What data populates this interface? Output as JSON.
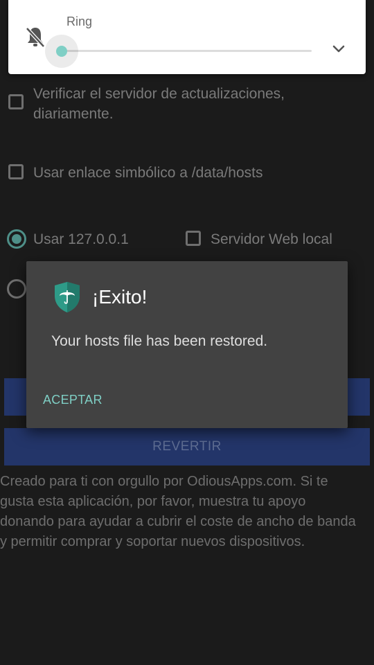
{
  "volume_panel": {
    "stream_label": "Ring",
    "level": 0,
    "accent_color": "#7fcfc5",
    "icons": {
      "muted": "bell-off-icon",
      "expand": "chevron-down-icon"
    }
  },
  "settings": {
    "daily_check_label": "Verificar el servidor de actualizaciones, diariamente.",
    "daily_check_checked": false,
    "symlink_label": "Usar enlace simbólico a /data/hosts",
    "symlink_checked": false,
    "use_localhost_label": "Usar 127.0.0.1",
    "use_localhost_selected": true,
    "local_webserver_label": "Servidor Web local",
    "local_webserver_checked": false
  },
  "buttons": {
    "revert_label": "REVERTIR",
    "color": "#233569"
  },
  "footer_text": "Creado para ti con orgullo por OdiousApps.com. Si te gusta esta aplicación, por favor, muestra tu apoyo donando para ayudar a cubrir el coste de ancho de banda y permitir comprar y soportar nuevos dispositivos.",
  "dialog": {
    "title": "¡Exito!",
    "message": "Your hosts file has been restored.",
    "accept_label": "ACEPTAR",
    "icon": "shield-umbrella-icon",
    "accent_color": "#7fcfc5"
  }
}
